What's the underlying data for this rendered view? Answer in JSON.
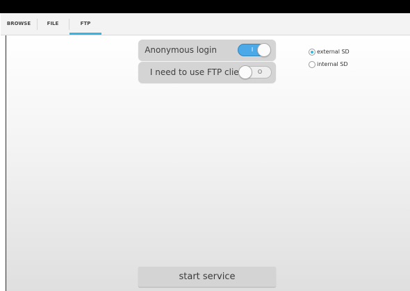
{
  "tabs": [
    {
      "label": "BROWSE",
      "selected": false
    },
    {
      "label": "FILE",
      "selected": false
    },
    {
      "label": "FTP",
      "selected": true
    }
  ],
  "colors": {
    "accent": "#33b5e5",
    "switch_on": "#4aa9e6",
    "row_background": "#d4d4d4"
  },
  "settings": {
    "anonymous_login": {
      "label": "Anonymous login",
      "switch_text": "I",
      "checked": true
    },
    "ftp_client": {
      "label": "I need to use FTP client",
      "switch_text": "O",
      "checked": false
    }
  },
  "storage": {
    "options": [
      {
        "label": "external SD",
        "selected": true
      },
      {
        "label": "internal SD",
        "selected": false
      }
    ]
  },
  "actions": {
    "start_label": "start service"
  }
}
